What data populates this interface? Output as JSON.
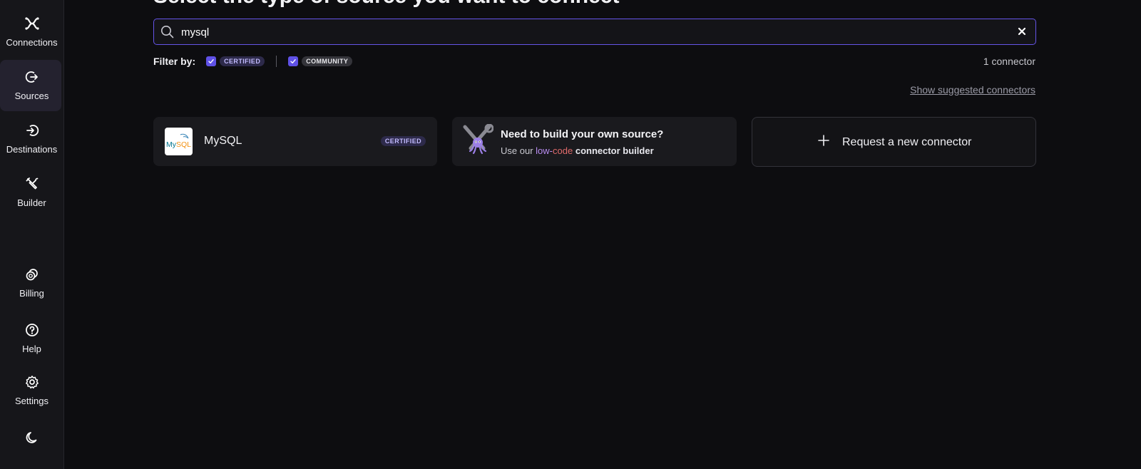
{
  "header": {
    "title": "Select the type of source you want to connect"
  },
  "sidebar": {
    "items": [
      {
        "label": "Connections",
        "icon": "connections-icon"
      },
      {
        "label": "Sources",
        "icon": "sources-icon"
      },
      {
        "label": "Destinations",
        "icon": "destinations-icon"
      },
      {
        "label": "Builder",
        "icon": "builder-icon"
      },
      {
        "label": "Billing",
        "icon": "billing-icon"
      },
      {
        "label": "Help",
        "icon": "help-icon"
      },
      {
        "label": "Settings",
        "icon": "settings-icon"
      }
    ],
    "active": "Sources",
    "theme_icon": "moon-icon"
  },
  "search": {
    "value": "mysql",
    "placeholder": ""
  },
  "filters": {
    "label": "Filter by:",
    "options": [
      {
        "label": "CERTIFIED",
        "checked": true
      },
      {
        "label": "COMMUNITY",
        "checked": true
      }
    ]
  },
  "result_count": "1 connector",
  "suggest_link": "Show suggested connectors",
  "cards": {
    "mysql": {
      "name": "MySQL",
      "logo_text": "MySQL",
      "badge": "CERTIFIED"
    },
    "builder": {
      "title": "Need to build your own source?",
      "sub_prefix": "Use our",
      "sub_low": "low",
      "sub_dash": "-",
      "sub_code": "code",
      "sub_bold": "connector builder"
    },
    "request": {
      "label": "Request a new connector"
    }
  },
  "colors": {
    "accent": "#6454e8",
    "background": "#0d0d10",
    "sidebar": "#16161a"
  }
}
